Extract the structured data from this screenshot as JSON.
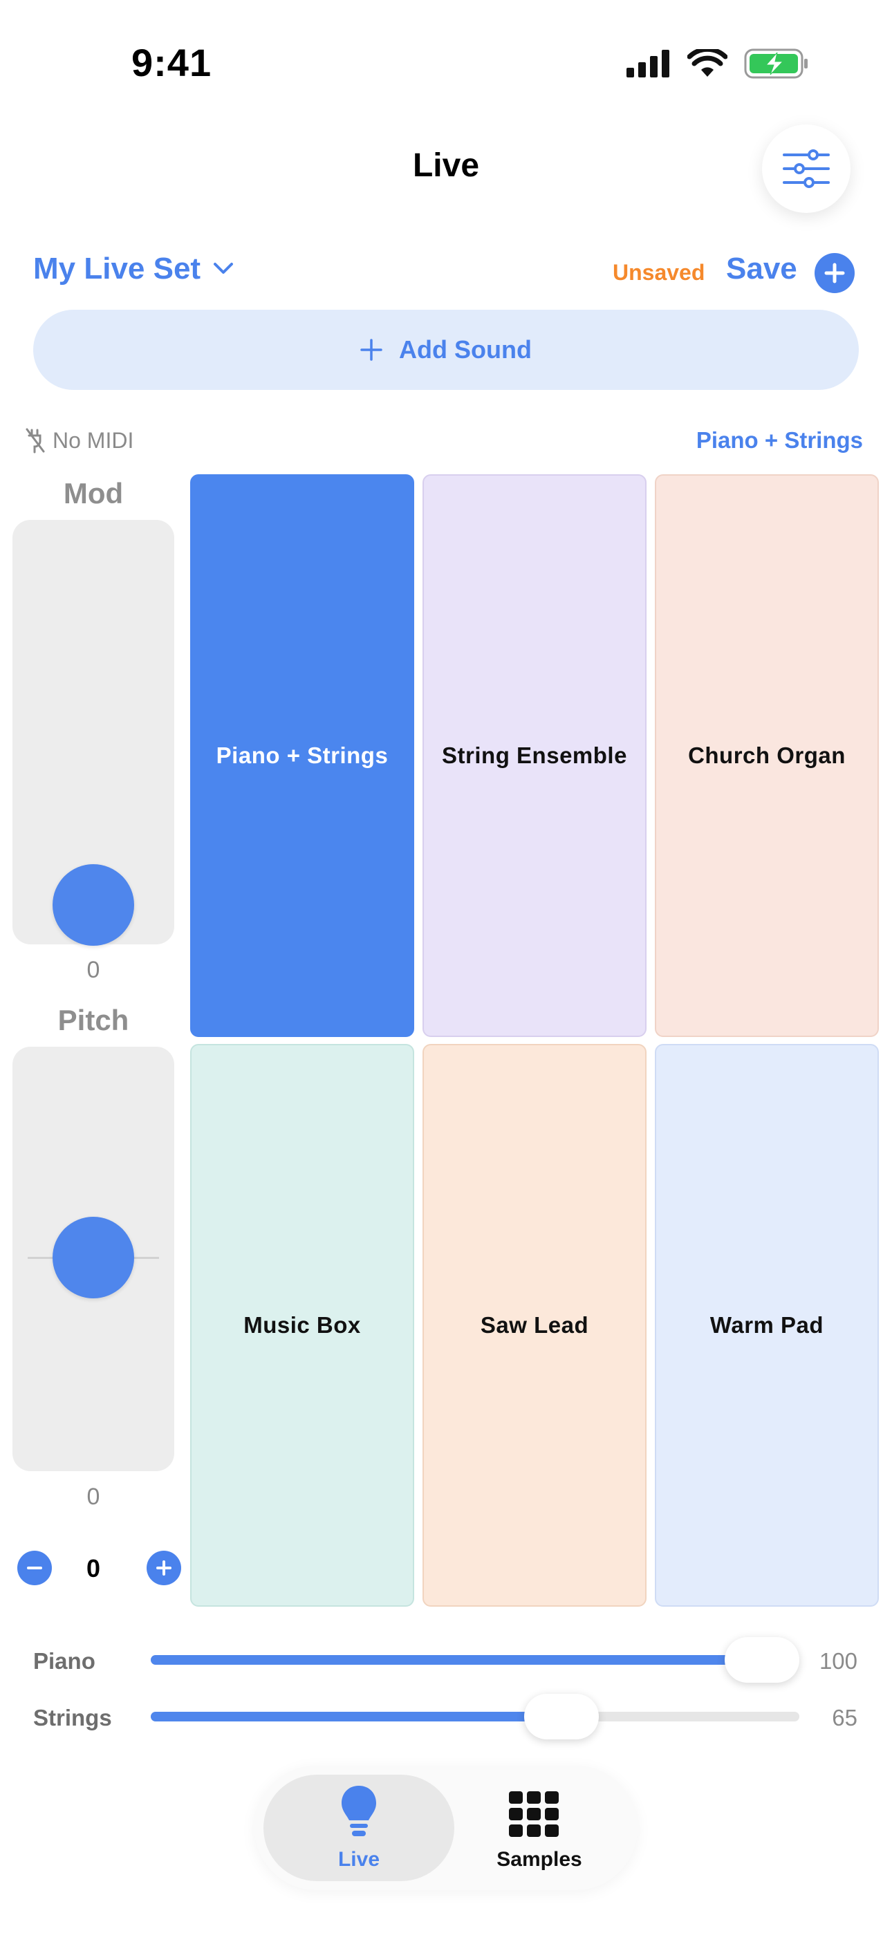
{
  "status_bar": {
    "time": "9:41"
  },
  "header": {
    "title": "Live",
    "settings_icon": "sliders-icon"
  },
  "set": {
    "name": "My Live Set",
    "unsaved_label": "Unsaved",
    "save_label": "Save"
  },
  "add_sound": {
    "label": "Add Sound"
  },
  "midi": {
    "status": "No MIDI",
    "current_preset": "Piano + Strings"
  },
  "controls": {
    "mod": {
      "label": "Mod",
      "value": "0",
      "level": 0
    },
    "pitch": {
      "label": "Pitch",
      "value": "0",
      "level": 0
    },
    "octave": {
      "value": "0"
    }
  },
  "pads": [
    {
      "label": "Piano + Strings",
      "bg": "#4b86ee",
      "fg": "#ffffff",
      "border": "#4b86ee",
      "active": true
    },
    {
      "label": "String Ensemble",
      "bg": "#e9e3f9",
      "fg": "#111111",
      "border": "#d8cfee"
    },
    {
      "label": "Church Organ",
      "bg": "#fae6df",
      "fg": "#111111",
      "border": "#f0d3c7"
    },
    {
      "label": "Music Box",
      "bg": "#dcf1ee",
      "fg": "#111111",
      "border": "#c5e4df"
    },
    {
      "label": "Saw Lead",
      "bg": "#fce8da",
      "fg": "#111111",
      "border": "#f1d4bf"
    },
    {
      "label": "Warm Pad",
      "bg": "#e3ecfc",
      "fg": "#111111",
      "border": "#cfdcf5"
    }
  ],
  "mixer": [
    {
      "label": "Piano",
      "value": "100",
      "fraction": 1.0
    },
    {
      "label": "Strings",
      "value": "65",
      "fraction": 0.65
    }
  ],
  "tabs": [
    {
      "label": "Live",
      "icon": "lightbulb-icon",
      "active": true
    },
    {
      "label": "Samples",
      "icon": "grid-icon",
      "active": false
    }
  ],
  "colors": {
    "accent": "#4a82ec",
    "warning": "#f5892c",
    "battery": "#34c759"
  }
}
